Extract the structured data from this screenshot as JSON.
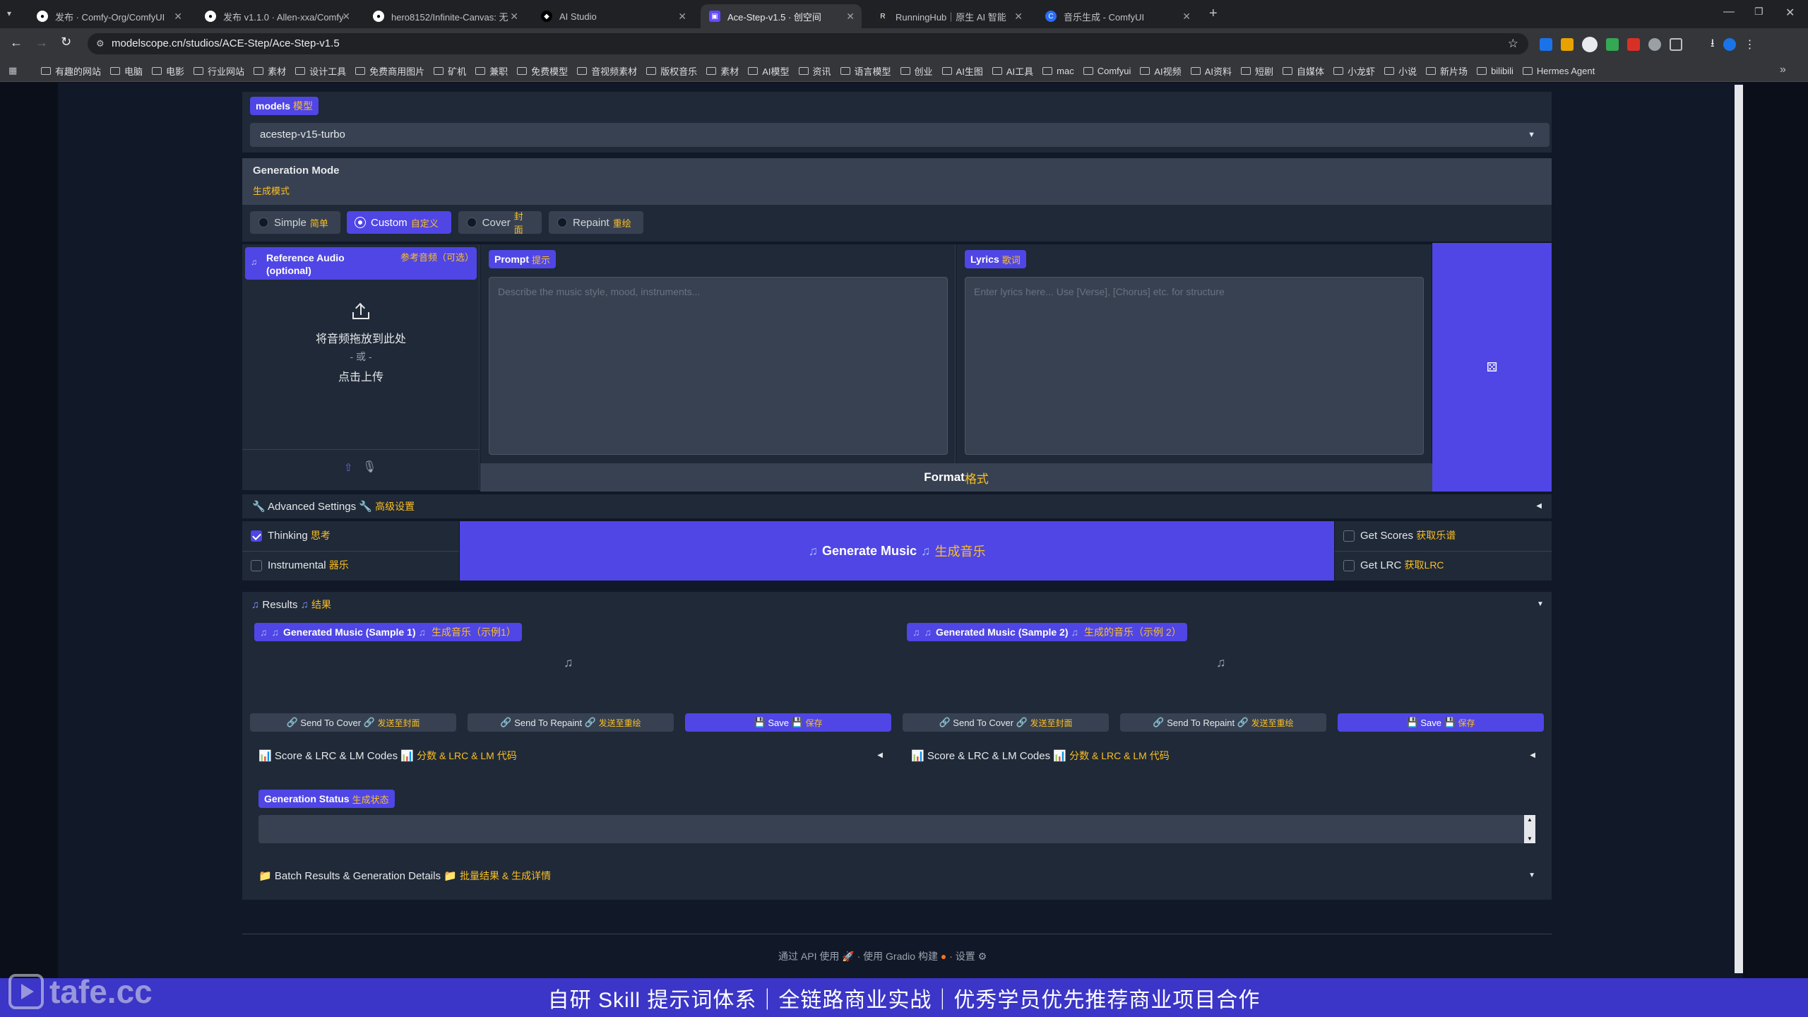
{
  "browser": {
    "tabs": [
      {
        "label": "发布 · Comfy-Org/ComfyUI",
        "icon": "github-icon"
      },
      {
        "label": "发布 v1.1.0 · Allen-xxa/Comfy",
        "icon": "github-icon"
      },
      {
        "label": "hero8152/Infinite-Canvas: 无",
        "icon": "github-icon"
      },
      {
        "label": "AI Studio",
        "icon": "ai-studio-icon"
      },
      {
        "label": "Ace-Step-v1.5 · 创空间",
        "icon": "modelscope-icon"
      },
      {
        "label": "RunningHub｜原生 AI 智能",
        "icon": "runninghub-icon"
      },
      {
        "label": "音乐生成 - ComfyUI",
        "icon": "comfyui-icon"
      }
    ],
    "url": "modelscope.cn/studios/ACE-Step/Ace-Step-v1.5",
    "bookmarks": [
      "有趣的网站",
      "电脑",
      "电影",
      "行业网站",
      "素材",
      "设计工具",
      "免费商用图片",
      "矿机",
      "兼职",
      "免费模型",
      "音视频素材",
      "版权音乐",
      "素材",
      "AI模型",
      "资讯",
      "语言模型",
      "创业",
      "AI生图",
      "AI工具",
      "mac",
      "Comfyui",
      "AI视频",
      "AI资料",
      "短剧",
      "自媒体",
      "小龙虾",
      "小说",
      "新片场",
      "bilibili",
      "Hermes Agent"
    ]
  },
  "models": {
    "label": "models",
    "label_cn": "模型",
    "selected": "acestep-v15-turbo"
  },
  "generation_mode": {
    "title": "Generation Mode",
    "title_cn": "生成模式",
    "options": [
      {
        "label": "Simple",
        "cn": "简单"
      },
      {
        "label": "Custom",
        "cn": "自定义"
      },
      {
        "label": "Cover",
        "cn": "封面"
      },
      {
        "label": "Repaint",
        "cn": "重绘"
      }
    ]
  },
  "reference_audio": {
    "label": "Reference Audio (optional)",
    "label_cn": "参考音频（可选）",
    "drop_text": "将音频拖放到此处",
    "or_text": "- 或 -",
    "click_text": "点击上传"
  },
  "prompt": {
    "label": "Prompt",
    "label_cn": "提示",
    "placeholder": "Describe the music style, mood, instruments..."
  },
  "lyrics": {
    "label": "Lyrics",
    "label_cn": "歌词",
    "placeholder": "Enter lyrics here... Use [Verse], [Chorus] etc. for structure"
  },
  "format_button": {
    "label": "Format",
    "label_cn": "格式"
  },
  "advanced": {
    "label": "Advanced Settings",
    "label_cn": "高级设置"
  },
  "options": {
    "thinking": {
      "label": "Thinking",
      "cn": "思考",
      "checked": true
    },
    "instrumental": {
      "label": "Instrumental",
      "cn": "器乐",
      "checked": false
    },
    "get_scores": {
      "label": "Get Scores",
      "cn": "获取乐谱",
      "checked": false
    },
    "get_lrc": {
      "label": "Get LRC",
      "cn": "获取LRC",
      "checked": false
    }
  },
  "generate_button": {
    "label": "Generate Music",
    "label_cn": "生成音乐"
  },
  "results": {
    "label": "Results",
    "label_cn": "结果",
    "samples": [
      {
        "title": "Generated Music (Sample 1)",
        "title_cn": "生成音乐（示例1）"
      },
      {
        "title": "Generated Music (Sample 2)",
        "title_cn": "生成的音乐（示例 2）"
      }
    ],
    "actions": {
      "send_cover": "Send To Cover",
      "send_cover_cn": "发送至封面",
      "send_repaint": "Send To Repaint",
      "send_repaint_cn": "发送至重绘",
      "save": "Save",
      "save_cn": "保存"
    },
    "score_codes": "Score & LRC & LM Codes",
    "score_codes_cn": "分数 & LRC & LM 代码"
  },
  "generation_status": {
    "label": "Generation Status",
    "label_cn": "生成状态"
  },
  "batch": {
    "label": "Batch Results & Generation Details",
    "label_cn": "批量结果 & 生成详情"
  },
  "footer": {
    "api": "通过 API 使用",
    "gradio": "使用 Gradio 构建",
    "settings": "设置",
    "sep": "·"
  },
  "watermark": "tafe.cc",
  "banner": "自研 Skill 提示词体系｜全链路商业实战｜优秀学员优先推荐商业项目合作",
  "colors": {
    "accent": "#4f46e5",
    "cn_text": "#fbbf24",
    "bg": "#111827",
    "panel": "#1f2937"
  }
}
